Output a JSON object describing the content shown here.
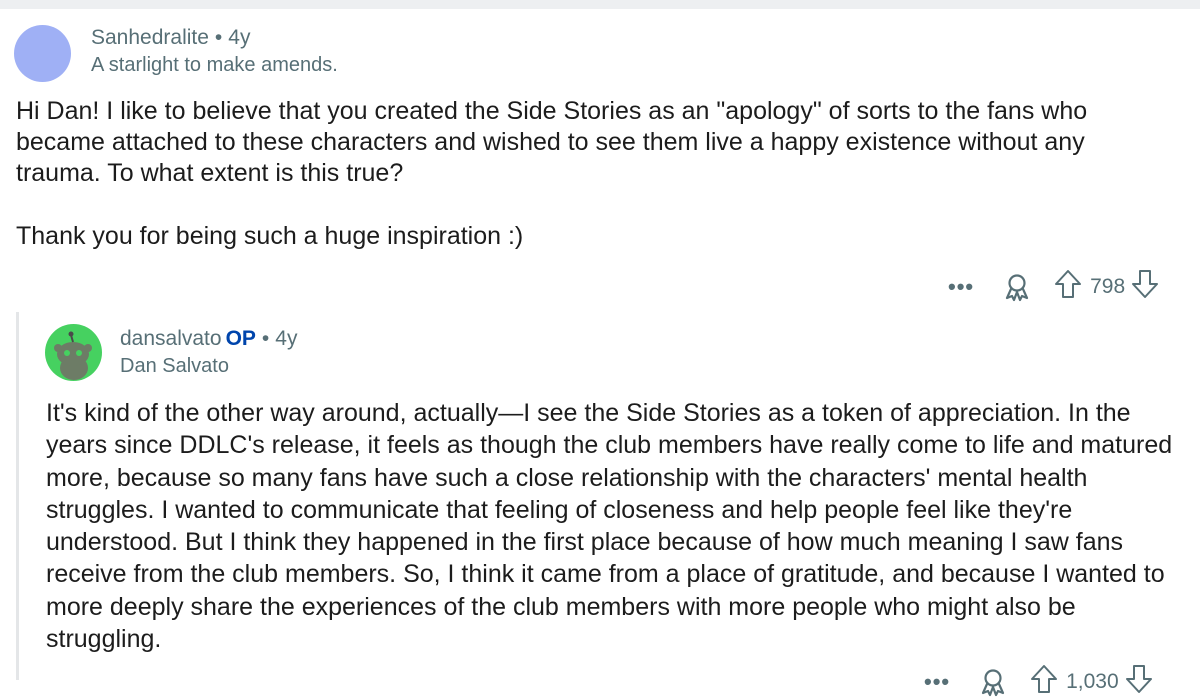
{
  "comment": {
    "username": "Sanhedralite",
    "separator": "•",
    "age": "4y",
    "flair": "A starlight to make amends.",
    "paragraphs": [
      "Hi Dan! I like to believe that you created the Side Stories as an \"apology\" of sorts to the fans who became attached to these characters and wished to see them live a happy existence without any trauma. To what extent is this true?",
      "Thank you for being such a huge inspiration :)"
    ],
    "actions": {
      "more": "•••",
      "award_icon": "award-icon",
      "upvote_icon": "upvote-arrow-icon",
      "downvote_icon": "downvote-arrow-icon",
      "score": "798"
    }
  },
  "reply": {
    "username": "dansalvato",
    "op_badge": "OP",
    "separator": "•",
    "age": "4y",
    "flair": "Dan Salvato",
    "avatar_icon": "snoo-avatar-icon",
    "paragraphs": [
      "It's kind of the other way around, actually—I see the Side Stories as a token of appreciation. In the years since DDLC's release, it feels as though the club members have really come to life and matured more, because so many fans have such a close relationship with the characters' mental health struggles. I wanted to communicate that feeling of closeness and help people feel like they're understood. But I think they happened in the first place because of how much meaning I saw fans receive from the club members. So, I think it came from a place of gratitude, and because I wanted to more deeply share the experiences of the club members with more people who might also be struggling."
    ],
    "actions": {
      "more": "•••",
      "score": "1,030"
    }
  },
  "colors": {
    "meta_gray": "#576f76",
    "op_blue": "#0045ac",
    "avatar1": "#9fb0f5",
    "avatar2": "#46d160",
    "thread_line": "#e4e6e8"
  }
}
